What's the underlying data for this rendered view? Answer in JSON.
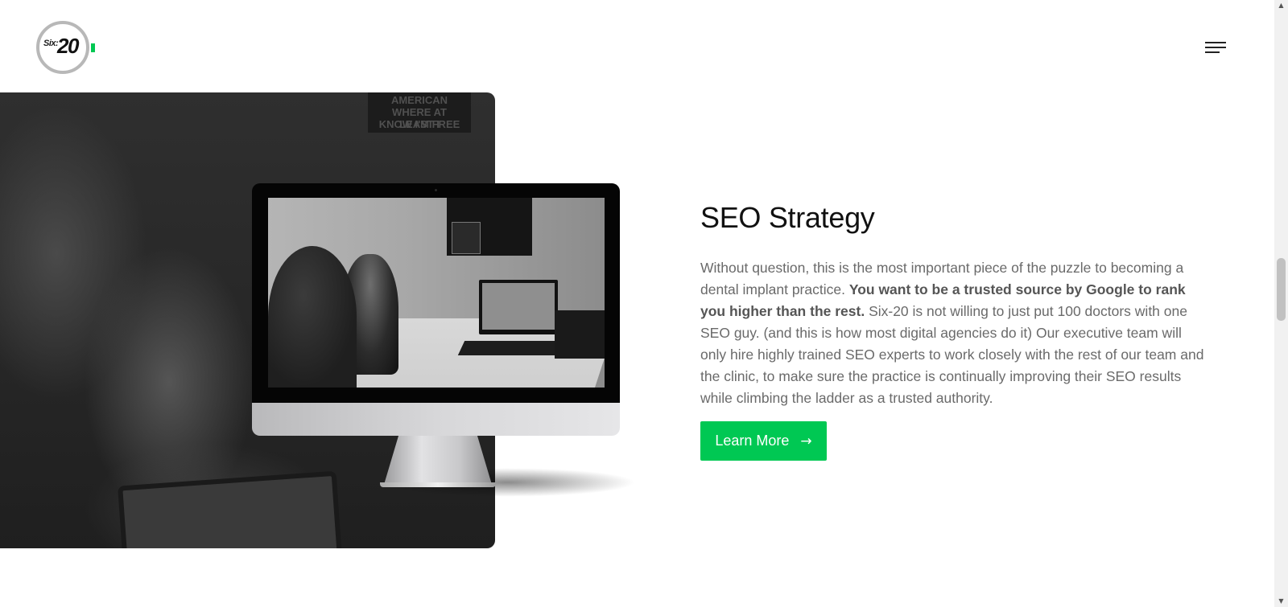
{
  "header": {
    "logo": {
      "six": "Six:",
      "twenty": "20"
    },
    "menu_icon": "hamburger-menu-icon"
  },
  "photo": {
    "poster_lines": [
      "AMERICAN",
      "WHERE AT LEAST I",
      "KNOW I'M FREE"
    ]
  },
  "section": {
    "title": "SEO Strategy",
    "paragraph_intro": "Without question, this is the most important piece of the puzzle to becoming a dental implant practice. ",
    "paragraph_bold": "You want to be a trusted source by Google to rank you higher than the rest.",
    "paragraph_rest": " Six-20 is not willing to just put 100 doctors with one SEO guy. (and this is how most digital agencies do it) Our executive team will only hire highly trained SEO experts to work closely with the rest of our team and the clinic, to make sure the practice is continually improving their SEO results while climbing the ladder as a trusted authority.",
    "cta_label": "Learn More",
    "cta_icon": "arrow-right-icon"
  },
  "scrollbar": {
    "up": "▲",
    "down": "▼"
  },
  "colors": {
    "accent": "#00c853",
    "heading": "#111111",
    "body": "#6a6a6a"
  }
}
